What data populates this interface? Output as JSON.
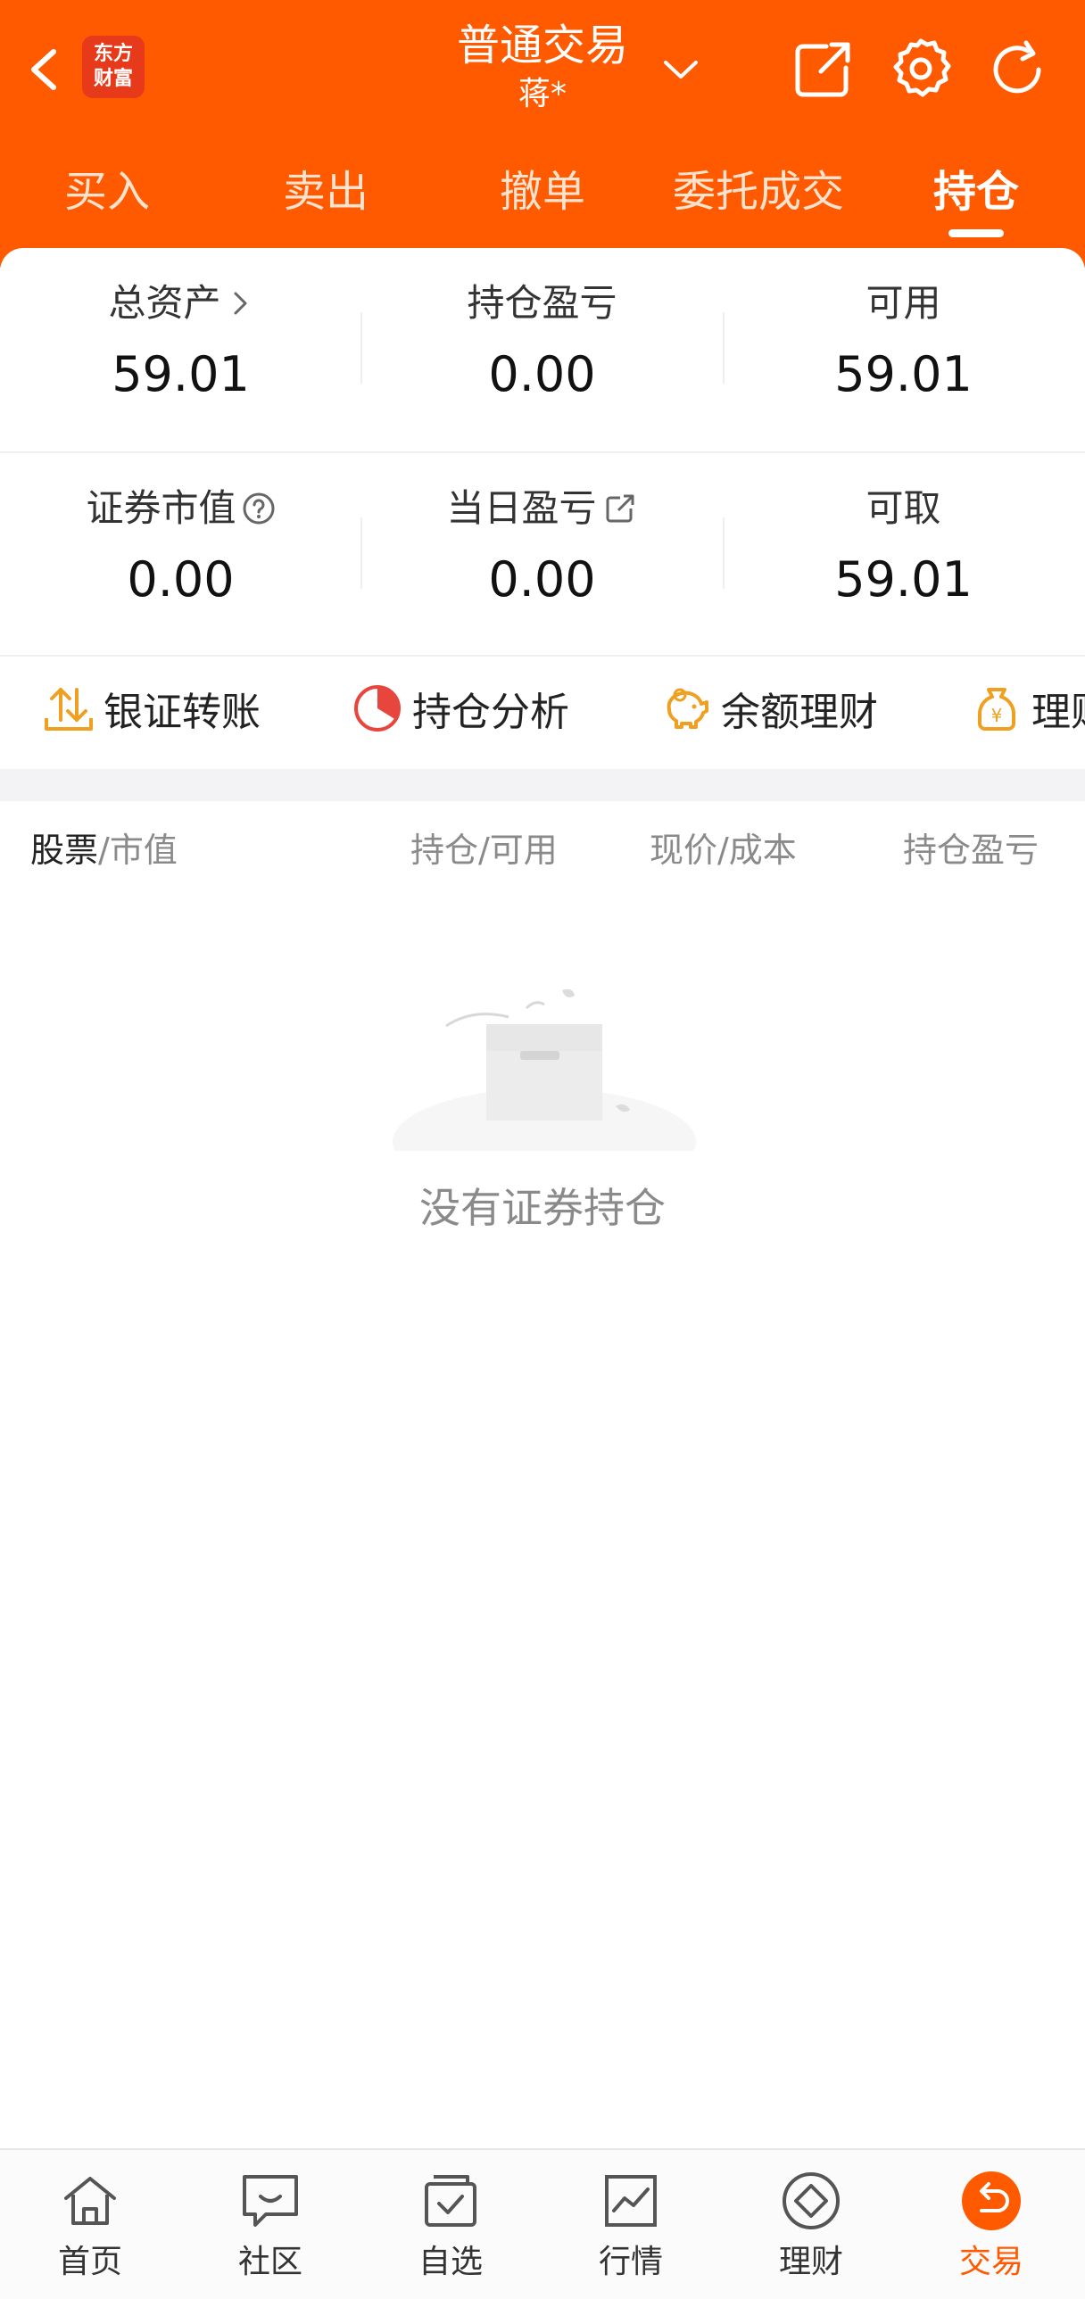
{
  "header": {
    "logo_line1": "东方",
    "logo_line2": "财富",
    "title": "普通交易",
    "account": "蒋*"
  },
  "tabs": [
    {
      "label": "买入"
    },
    {
      "label": "卖出"
    },
    {
      "label": "撤单"
    },
    {
      "label": "委托成交"
    },
    {
      "label": "持仓",
      "active": true
    }
  ],
  "summary": {
    "total_assets_label": "总资产",
    "total_assets": "59.01",
    "position_pnl_label": "持仓盈亏",
    "position_pnl": "0.00",
    "available_label": "可用",
    "available": "59.01",
    "market_value_label": "证券市值",
    "market_value": "0.00",
    "daily_pnl_label": "当日盈亏",
    "daily_pnl": "0.00",
    "withdrawable_label": "可取",
    "withdrawable": "59.01"
  },
  "quick_actions": [
    {
      "label": "银证转账",
      "icon": "transfer-icon"
    },
    {
      "label": "持仓分析",
      "icon": "pie-chart-icon"
    },
    {
      "label": "余额理财",
      "icon": "piggy-bank-icon"
    },
    {
      "label": "理财",
      "icon": "money-bag-icon"
    }
  ],
  "table_header": {
    "stock": "股票",
    "market_value": "/市值",
    "position": "持仓/可用",
    "price": "现价/成本",
    "pnl": "持仓盈亏"
  },
  "empty_state": {
    "text": "没有证券持仓"
  },
  "bottom_nav": [
    {
      "label": "首页",
      "icon": "home-icon"
    },
    {
      "label": "社区",
      "icon": "chat-icon"
    },
    {
      "label": "自选",
      "icon": "watchlist-icon"
    },
    {
      "label": "行情",
      "icon": "market-chart-icon"
    },
    {
      "label": "理财",
      "icon": "finance-diamond-icon"
    },
    {
      "label": "交易",
      "icon": "trade-icon",
      "active": true
    }
  ],
  "colors": {
    "brand": "#ff5a00",
    "logo": "#e63a1a",
    "pie_red": "#e8453c",
    "gold": "#f0a020"
  }
}
